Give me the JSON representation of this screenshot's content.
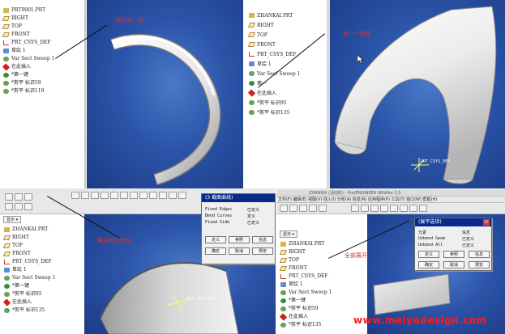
{
  "panel1": {
    "tree": [
      "PRT0001.PRT",
      "RIGHT",
      "TOP",
      "FRONT",
      "PRT_CSYS_DEF",
      "草绘 1",
      "Var Sect Sweep 1",
      "在此插入",
      "*第一键",
      "*剪平 标识59",
      "*剪平 标识119"
    ],
    "annotation": "选中第一条"
  },
  "panel2": {
    "tree": [
      "ZHANKAI.PRT",
      "RIGHT",
      "TOP",
      "FRONT",
      "PRT_CSYS_DEF",
      "草绘 1",
      "Var Sect Sweep 1",
      "第一",
      "在此插入",
      "*剪平 标识95",
      "*剪平 标识135"
    ],
    "annotation": "选一个特征",
    "csys_label": "PRT_CSYS_DEF"
  },
  "panel3": {
    "tree": [
      "ZHANKAI.PRT",
      "RIGHT",
      "TOP",
      "FRONT",
      "PRT_CSYS_DEF",
      "草绘 1",
      "Var Sect Sweep 1",
      "*第一键",
      "*剪平 标识95",
      "在此插入",
      "*剪平 标识135"
    ],
    "show_label": "显示 ▾",
    "dialog": {
      "title": "(3 截面曲线)",
      "rows": [
        [
          "Fixed Edges",
          "已定义"
        ],
        [
          "Bend Curves",
          "定义"
        ],
        [
          "Fixed Side",
          "已定义"
        ]
      ],
      "buttons": [
        "定义",
        "参照",
        "信息",
        "确定",
        "取消",
        "预览"
      ]
    },
    "annotation": "展开后的特征",
    "csys_label": "PRT_CSYS_DEF"
  },
  "panel4": {
    "title_bar": "ZHANKAI (活动的) - Pro/ENGINEER Wildfire 2.0",
    "menu": "文件(F)  编辑(E)  视图(V)  插入(I)  分析(A)  信息(N)  应用程序(P)  工具(T)  窗口(W)  帮助(H)",
    "tree": [
      "ZHANKAI.PRT",
      "RIGHT",
      "TOP",
      "FRONT",
      "PRT_CSYS_DEF",
      "草绘 1",
      "Var Sect Sweep 1",
      "*第一键",
      "*剪平 标识59",
      "在此插入",
      "*剪平 标识135"
    ],
    "show_label": "显示 ▾",
    "dialog": {
      "title": "(展平选项)",
      "rows": [
        [
          "元素",
          "信息"
        ],
        [
          "Unbend Geom",
          "已定义"
        ],
        [
          "Unbend All",
          "已定义"
        ]
      ],
      "buttons": [
        "定义",
        "参照",
        "信息",
        "确定",
        "取消",
        "预览"
      ]
    },
    "annotation": "全部展开"
  },
  "watermark": "www.meiyadesign.com"
}
